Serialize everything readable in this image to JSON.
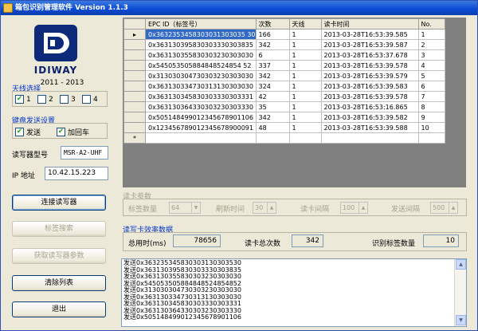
{
  "window": {
    "title": "箱包识别管理软件 Version 1.1.3"
  },
  "brand": {
    "logo_text": "IDIWAY",
    "years": "2011 - 2013"
  },
  "antenna": {
    "title": "天线选择",
    "options": [
      {
        "label": "1",
        "checked": true
      },
      {
        "label": "2",
        "checked": false
      },
      {
        "label": "3",
        "checked": false
      },
      {
        "label": "4",
        "checked": false
      }
    ]
  },
  "keyboard": {
    "title": "键盘发送设置",
    "send_label": "发送",
    "send_checked": true,
    "enter_label": "加回车",
    "enter_checked": true
  },
  "reader": {
    "model_label": "读写器型号",
    "model_value": "MSR-A2-UHF",
    "ip_label": "IP 地址",
    "ip_value": "10.42.15.223"
  },
  "buttons": {
    "connect": "连接读写器",
    "search_tag": "标签搜索",
    "get_params": "获取读写器参数",
    "clear_list": "清除列表",
    "exit": "退出"
  },
  "grid": {
    "columns": [
      "EPC ID（标签号）",
      "次数",
      "天线",
      "读卡时间",
      "No."
    ],
    "rows": [
      {
        "epc": "0x3632353458303031303035 30",
        "count": "166",
        "antenna": "1",
        "time": "2013-03-28T16:53:39.585",
        "no": "1"
      },
      {
        "epc": "0x363130395830303330303835",
        "count": "342",
        "antenna": "1",
        "time": "2013-03-28T16:53:39.587",
        "no": "2"
      },
      {
        "epc": "0x363130355830303230303030",
        "count": "6",
        "antenna": "1",
        "time": "2013-03-28T16:53:37.678",
        "no": "3"
      },
      {
        "epc": "0x545053505884848524854 52",
        "count": "337",
        "antenna": "1",
        "time": "2013-03-28T16:53:39.578",
        "no": "4"
      },
      {
        "epc": "0x313030304730303230303030",
        "count": "342",
        "antenna": "1",
        "time": "2013-03-28T16:53:39.579",
        "no": "5"
      },
      {
        "epc": "0x363130334730313130303030",
        "count": "324",
        "antenna": "1",
        "time": "2013-03-28T16:53:39.583",
        "no": "6"
      },
      {
        "epc": "0x363130345830303330303331",
        "count": "42",
        "antenna": "1",
        "time": "2013-03-28T16:53:39.578",
        "no": "7"
      },
      {
        "epc": "0x363130364330303230303330",
        "count": "35",
        "antenna": "1",
        "time": "2013-03-28T16:53:16.865",
        "no": "8"
      },
      {
        "epc": "0x505148499012345678901106",
        "count": "342",
        "antenna": "1",
        "time": "2013-03-28T16:53:39.582",
        "no": "9"
      },
      {
        "epc": "0x123456789012345678900091",
        "count": "48",
        "antenna": "1",
        "time": "2013-03-28T16:53:39.588",
        "no": "10"
      }
    ],
    "new_row_marker": "*",
    "current_row_marker": "▸"
  },
  "reader_params": {
    "title": "读卡参数",
    "tag_count_label": "标签数量",
    "tag_count_value": "64",
    "refresh_label": "刷新时间",
    "refresh_value": "30",
    "read_interval_label": "读卡间隔",
    "read_interval_value": "100",
    "send_interval_label": "发送间隔",
    "send_interval_value": "500"
  },
  "stats": {
    "title": "读写卡效率数据",
    "total_time_label": "总用时(ms)",
    "total_time_value": "78656",
    "total_reads_label": "读卡总次数",
    "total_reads_value": "342",
    "tag_count_label": "识别标签数量",
    "tag_count_value": "10"
  },
  "log": {
    "lines": [
      "发送0x363235345830303130303530",
      "发送0x363130395830303330303835",
      "发送0x363130355830303230303030",
      "发送0x545053505884848524854852",
      "发送0x313030304730303230303030",
      "发送0x363130334730313130303030",
      "发送0x363130345830303330303331",
      "发送0x363130364330303230303330",
      "发送0x505148499012345678901106"
    ]
  },
  "colors": {
    "title_bar": "#0a4ad4",
    "selection": "#316ac5",
    "group_label": "#0033cc",
    "check": "#21a121"
  }
}
